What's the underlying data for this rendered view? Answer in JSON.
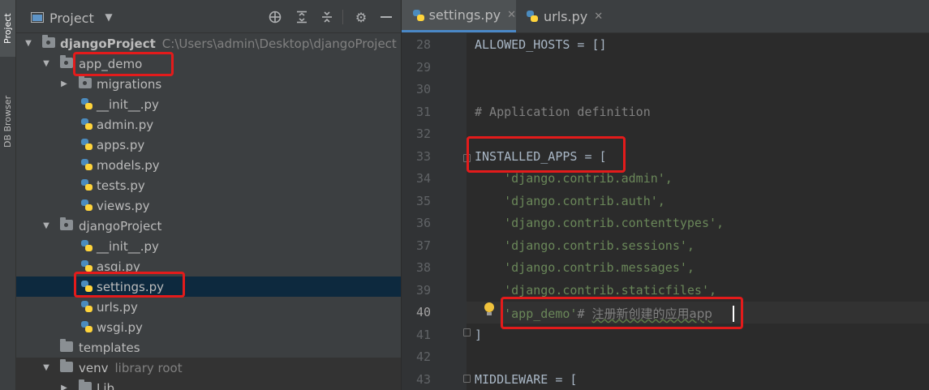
{
  "toolstrip": {
    "project_tab": "Project",
    "db_browser_tab": "DB Browser"
  },
  "project_panel": {
    "title": "Project",
    "tree": [
      {
        "label": "djangoProject",
        "hint": "C:\\Users\\admin\\Desktop\\djangoProject",
        "type": "module-folder",
        "expanded": true
      },
      {
        "label": "app_demo",
        "type": "module-folder",
        "expanded": true
      },
      {
        "label": "migrations",
        "type": "module-folder",
        "expanded": false
      },
      {
        "label": "__init__.py",
        "type": "python-file"
      },
      {
        "label": "admin.py",
        "type": "python-file"
      },
      {
        "label": "apps.py",
        "type": "python-file"
      },
      {
        "label": "models.py",
        "type": "python-file"
      },
      {
        "label": "tests.py",
        "type": "python-file"
      },
      {
        "label": "views.py",
        "type": "python-file"
      },
      {
        "label": "djangoProject",
        "type": "module-folder",
        "expanded": true
      },
      {
        "label": "__init__.py",
        "type": "python-file"
      },
      {
        "label": "asgi.py",
        "type": "python-file"
      },
      {
        "label": "settings.py",
        "type": "python-file",
        "selected": true
      },
      {
        "label": "urls.py",
        "type": "python-file"
      },
      {
        "label": "wsgi.py",
        "type": "python-file"
      },
      {
        "label": "templates",
        "type": "folder"
      },
      {
        "label": "venv",
        "hint": "library root",
        "type": "folder",
        "expanded": true
      },
      {
        "label": "Lib",
        "type": "folder",
        "expanded": false
      }
    ]
  },
  "editor": {
    "tabs": [
      {
        "label": "settings.py",
        "active": true
      },
      {
        "label": "urls.py",
        "active": false
      }
    ],
    "lines": [
      {
        "num": "28",
        "text": "ALLOWED_HOSTS = []"
      },
      {
        "num": "29",
        "text": ""
      },
      {
        "num": "30",
        "text": ""
      },
      {
        "num": "31",
        "text": "# Application definition"
      },
      {
        "num": "32",
        "text": ""
      },
      {
        "num": "33",
        "text": "INSTALLED_APPS = ["
      },
      {
        "num": "34",
        "text": "    'django.contrib.admin',"
      },
      {
        "num": "35",
        "text": "    'django.contrib.auth',"
      },
      {
        "num": "36",
        "text": "    'django.contrib.contenttypes',"
      },
      {
        "num": "37",
        "text": "    'django.contrib.sessions',"
      },
      {
        "num": "38",
        "text": "    'django.contrib.messages',"
      },
      {
        "num": "39",
        "text": "    'django.contrib.staticfiles',"
      },
      {
        "num": "40",
        "text": "    'app_demo'# 注册新创建的应用app"
      },
      {
        "num": "41",
        "text": "]"
      },
      {
        "num": "42",
        "text": ""
      },
      {
        "num": "43",
        "text": "MIDDLEWARE = ["
      }
    ],
    "line40_string": "'app_demo'",
    "line40_comment_hash": "# ",
    "line40_comment_text": "注册新创建的应用app"
  },
  "colors": {
    "highlight_box": "#e31b1b",
    "selection": "#0d293e",
    "string": "#6a8759",
    "comment": "#808080"
  }
}
